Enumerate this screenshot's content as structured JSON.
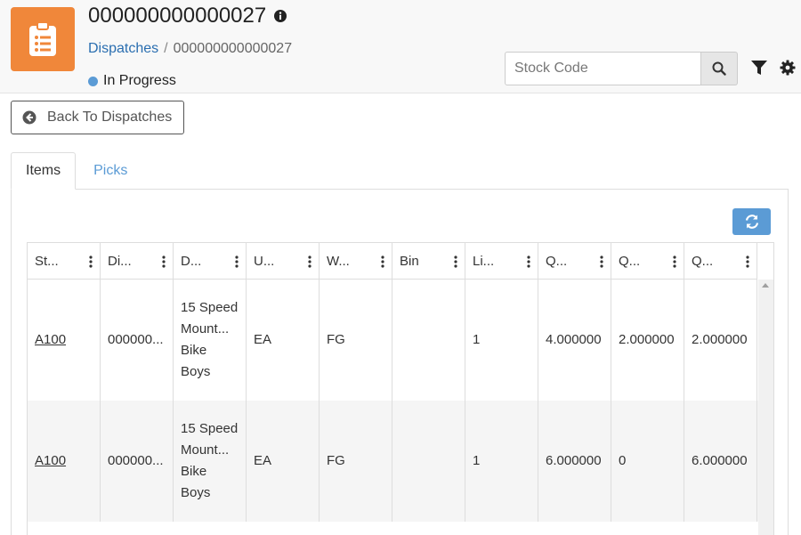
{
  "header": {
    "title": "000000000000027",
    "breadcrumb": {
      "parent": "Dispatches",
      "separator": "/",
      "current": "000000000000027"
    },
    "status": "In Progress",
    "search": {
      "placeholder": "Stock Code",
      "value": ""
    }
  },
  "toolbar": {
    "back_label": "Back To Dispatches"
  },
  "tabs": [
    {
      "label": "Items",
      "active": true
    },
    {
      "label": "Picks",
      "active": false
    }
  ],
  "grid": {
    "columns": [
      "St...",
      "Di...",
      "D...",
      "U...",
      "W...",
      "Bin",
      "Li...",
      "Q...",
      "Q...",
      "Q..."
    ],
    "rows": [
      [
        "A100",
        "000000...",
        "15 Speed Mount... Bike Boys",
        "EA",
        "FG",
        "",
        "1",
        "4.000000",
        "2.000000",
        "2.000000"
      ],
      [
        "A100",
        "000000...",
        "15 Speed Mount... Bike Boys",
        "EA",
        "FG",
        "",
        "1",
        "6.000000",
        "0",
        "6.000000"
      ]
    ]
  },
  "colors": {
    "app_icon": "#f0873a",
    "link": "#2a6eb0",
    "status_dot": "#5b9bd5",
    "accent": "#5b9bd5"
  },
  "icons": {
    "app": "clipboard-list-icon",
    "info": "info-icon",
    "search": "search-icon",
    "filter": "filter-icon",
    "settings": "gear-icon",
    "back": "arrow-left-circle-icon",
    "refresh": "refresh-icon",
    "column_menu": "kebab-icon"
  }
}
